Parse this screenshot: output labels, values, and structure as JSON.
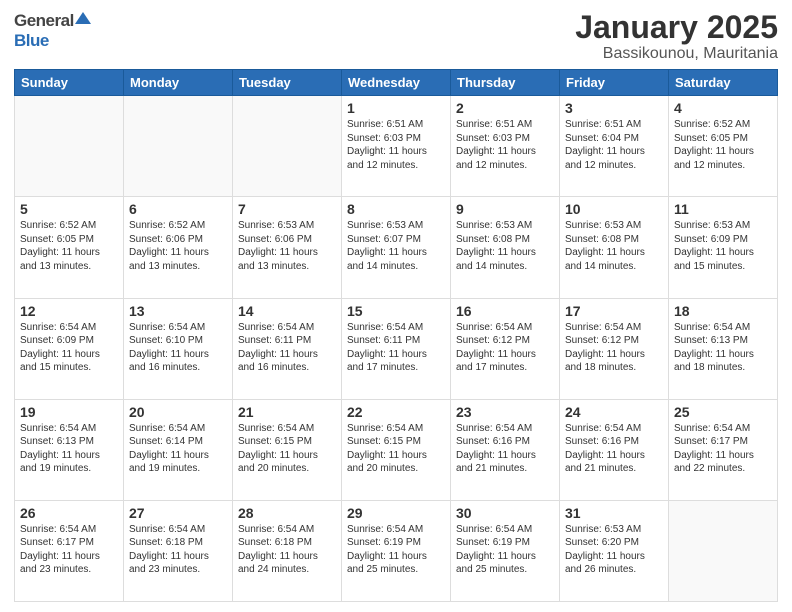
{
  "logo": {
    "general": "General",
    "blue": "Blue"
  },
  "title": "January 2025",
  "subtitle": "Bassikounou, Mauritania",
  "days_of_week": [
    "Sunday",
    "Monday",
    "Tuesday",
    "Wednesday",
    "Thursday",
    "Friday",
    "Saturday"
  ],
  "weeks": [
    [
      {
        "day": "",
        "sunrise": "",
        "sunset": "",
        "daylight": ""
      },
      {
        "day": "",
        "sunrise": "",
        "sunset": "",
        "daylight": ""
      },
      {
        "day": "",
        "sunrise": "",
        "sunset": "",
        "daylight": ""
      },
      {
        "day": "1",
        "sunrise": "Sunrise: 6:51 AM",
        "sunset": "Sunset: 6:03 PM",
        "daylight": "Daylight: 11 hours and 12 minutes."
      },
      {
        "day": "2",
        "sunrise": "Sunrise: 6:51 AM",
        "sunset": "Sunset: 6:03 PM",
        "daylight": "Daylight: 11 hours and 12 minutes."
      },
      {
        "day": "3",
        "sunrise": "Sunrise: 6:51 AM",
        "sunset": "Sunset: 6:04 PM",
        "daylight": "Daylight: 11 hours and 12 minutes."
      },
      {
        "day": "4",
        "sunrise": "Sunrise: 6:52 AM",
        "sunset": "Sunset: 6:05 PM",
        "daylight": "Daylight: 11 hours and 12 minutes."
      }
    ],
    [
      {
        "day": "5",
        "sunrise": "Sunrise: 6:52 AM",
        "sunset": "Sunset: 6:05 PM",
        "daylight": "Daylight: 11 hours and 13 minutes."
      },
      {
        "day": "6",
        "sunrise": "Sunrise: 6:52 AM",
        "sunset": "Sunset: 6:06 PM",
        "daylight": "Daylight: 11 hours and 13 minutes."
      },
      {
        "day": "7",
        "sunrise": "Sunrise: 6:53 AM",
        "sunset": "Sunset: 6:06 PM",
        "daylight": "Daylight: 11 hours and 13 minutes."
      },
      {
        "day": "8",
        "sunrise": "Sunrise: 6:53 AM",
        "sunset": "Sunset: 6:07 PM",
        "daylight": "Daylight: 11 hours and 14 minutes."
      },
      {
        "day": "9",
        "sunrise": "Sunrise: 6:53 AM",
        "sunset": "Sunset: 6:08 PM",
        "daylight": "Daylight: 11 hours and 14 minutes."
      },
      {
        "day": "10",
        "sunrise": "Sunrise: 6:53 AM",
        "sunset": "Sunset: 6:08 PM",
        "daylight": "Daylight: 11 hours and 14 minutes."
      },
      {
        "day": "11",
        "sunrise": "Sunrise: 6:53 AM",
        "sunset": "Sunset: 6:09 PM",
        "daylight": "Daylight: 11 hours and 15 minutes."
      }
    ],
    [
      {
        "day": "12",
        "sunrise": "Sunrise: 6:54 AM",
        "sunset": "Sunset: 6:09 PM",
        "daylight": "Daylight: 11 hours and 15 minutes."
      },
      {
        "day": "13",
        "sunrise": "Sunrise: 6:54 AM",
        "sunset": "Sunset: 6:10 PM",
        "daylight": "Daylight: 11 hours and 16 minutes."
      },
      {
        "day": "14",
        "sunrise": "Sunrise: 6:54 AM",
        "sunset": "Sunset: 6:11 PM",
        "daylight": "Daylight: 11 hours and 16 minutes."
      },
      {
        "day": "15",
        "sunrise": "Sunrise: 6:54 AM",
        "sunset": "Sunset: 6:11 PM",
        "daylight": "Daylight: 11 hours and 17 minutes."
      },
      {
        "day": "16",
        "sunrise": "Sunrise: 6:54 AM",
        "sunset": "Sunset: 6:12 PM",
        "daylight": "Daylight: 11 hours and 17 minutes."
      },
      {
        "day": "17",
        "sunrise": "Sunrise: 6:54 AM",
        "sunset": "Sunset: 6:12 PM",
        "daylight": "Daylight: 11 hours and 18 minutes."
      },
      {
        "day": "18",
        "sunrise": "Sunrise: 6:54 AM",
        "sunset": "Sunset: 6:13 PM",
        "daylight": "Daylight: 11 hours and 18 minutes."
      }
    ],
    [
      {
        "day": "19",
        "sunrise": "Sunrise: 6:54 AM",
        "sunset": "Sunset: 6:13 PM",
        "daylight": "Daylight: 11 hours and 19 minutes."
      },
      {
        "day": "20",
        "sunrise": "Sunrise: 6:54 AM",
        "sunset": "Sunset: 6:14 PM",
        "daylight": "Daylight: 11 hours and 19 minutes."
      },
      {
        "day": "21",
        "sunrise": "Sunrise: 6:54 AM",
        "sunset": "Sunset: 6:15 PM",
        "daylight": "Daylight: 11 hours and 20 minutes."
      },
      {
        "day": "22",
        "sunrise": "Sunrise: 6:54 AM",
        "sunset": "Sunset: 6:15 PM",
        "daylight": "Daylight: 11 hours and 20 minutes."
      },
      {
        "day": "23",
        "sunrise": "Sunrise: 6:54 AM",
        "sunset": "Sunset: 6:16 PM",
        "daylight": "Daylight: 11 hours and 21 minutes."
      },
      {
        "day": "24",
        "sunrise": "Sunrise: 6:54 AM",
        "sunset": "Sunset: 6:16 PM",
        "daylight": "Daylight: 11 hours and 21 minutes."
      },
      {
        "day": "25",
        "sunrise": "Sunrise: 6:54 AM",
        "sunset": "Sunset: 6:17 PM",
        "daylight": "Daylight: 11 hours and 22 minutes."
      }
    ],
    [
      {
        "day": "26",
        "sunrise": "Sunrise: 6:54 AM",
        "sunset": "Sunset: 6:17 PM",
        "daylight": "Daylight: 11 hours and 23 minutes."
      },
      {
        "day": "27",
        "sunrise": "Sunrise: 6:54 AM",
        "sunset": "Sunset: 6:18 PM",
        "daylight": "Daylight: 11 hours and 23 minutes."
      },
      {
        "day": "28",
        "sunrise": "Sunrise: 6:54 AM",
        "sunset": "Sunset: 6:18 PM",
        "daylight": "Daylight: 11 hours and 24 minutes."
      },
      {
        "day": "29",
        "sunrise": "Sunrise: 6:54 AM",
        "sunset": "Sunset: 6:19 PM",
        "daylight": "Daylight: 11 hours and 25 minutes."
      },
      {
        "day": "30",
        "sunrise": "Sunrise: 6:54 AM",
        "sunset": "Sunset: 6:19 PM",
        "daylight": "Daylight: 11 hours and 25 minutes."
      },
      {
        "day": "31",
        "sunrise": "Sunrise: 6:53 AM",
        "sunset": "Sunset: 6:20 PM",
        "daylight": "Daylight: 11 hours and 26 minutes."
      },
      {
        "day": "",
        "sunrise": "",
        "sunset": "",
        "daylight": ""
      }
    ]
  ]
}
